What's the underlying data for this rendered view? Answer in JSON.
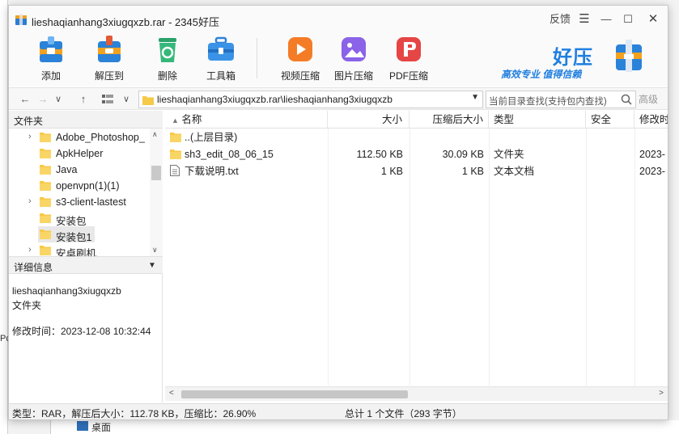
{
  "window": {
    "title": "lieshaqianhang3xiugqxzb.rar - 2345好压",
    "feedback": "反馈"
  },
  "toolbar": {
    "add": "添加",
    "extract_to": "解压到",
    "delete": "删除",
    "toolbox": "工具箱",
    "video_compress": "视频压缩",
    "image_compress": "图片压缩",
    "pdf_compress": "PDF压缩"
  },
  "brand": {
    "title": "好压",
    "slogan": "高效专业  值得信赖"
  },
  "addressbar": {
    "path": "lieshaqianhang3xiugqxzb.rar\\lieshaqianhang3xiugqxzb",
    "search_placeholder": "当前目录查找(支持包内查找)",
    "search_button": "高级"
  },
  "left_panel": {
    "header": "文件夹",
    "tree": [
      {
        "label": "Adobe_Photoshop_",
        "expandable": true
      },
      {
        "label": "ApkHelper",
        "expandable": false
      },
      {
        "label": "Java",
        "expandable": false
      },
      {
        "label": "openvpn(1)(1)",
        "expandable": false
      },
      {
        "label": "s3-client-lastest",
        "expandable": true
      },
      {
        "label": "安装包",
        "expandable": false
      },
      {
        "label": "安装包1",
        "expandable": false,
        "selected": true
      },
      {
        "label": "安卓刷机",
        "expandable": true
      }
    ],
    "detail_header": "详细信息",
    "detail_name": "lieshaqianhang3xiugqxzb",
    "detail_type": "文件夹",
    "detail_modified": "修改时间：2023-12-08 10:32:44"
  },
  "file_list": {
    "columns": {
      "name": "名称",
      "size": "大小",
      "packed": "压缩后大小",
      "type": "类型",
      "security": "安全",
      "modified": "修改时"
    },
    "rows": [
      {
        "name": "..(上层目录)",
        "size": "",
        "packed": "",
        "type": "",
        "security": "",
        "modified": "",
        "icon": "folder-icon"
      },
      {
        "name": "sh3_edit_08_06_15",
        "size": "112.50 KB",
        "packed": "30.09 KB",
        "type": "文件夹",
        "security": "",
        "modified": "2023-",
        "icon": "folder-icon"
      },
      {
        "name": "下载说明.txt",
        "size": "1 KB",
        "packed": "1 KB",
        "type": "文本文档",
        "security": "",
        "modified": "2023-",
        "icon": "text-file-icon"
      }
    ]
  },
  "statusbar": {
    "left": "类型：RAR，解压后大小：112.78 KB，压缩比：26.90%",
    "right": "总计 1 个文件（293 字节）"
  },
  "background": {
    "bottom_text": "桌面",
    "left_text": "Pc"
  }
}
